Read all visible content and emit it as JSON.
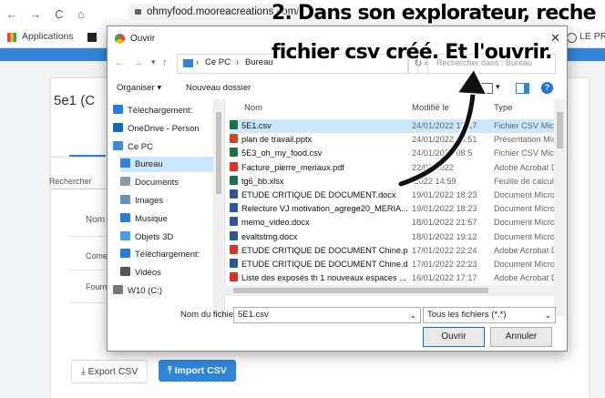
{
  "browser": {
    "back": "←",
    "forward": "→",
    "reload": "C",
    "home": "⌂",
    "url": "ohmyfood.mooreacreations.com/",
    "bookmarks": {
      "apps": "Applications",
      "right": "LE PR"
    }
  },
  "page": {
    "heading": "5e1 (C",
    "search_label": "Rechercher",
    "col_name": "Nom",
    "row1": "Comer",
    "row2": "Fourm",
    "export_label": "Export CSV",
    "import_label": "Import CSV"
  },
  "dialog": {
    "title": "Ouvrir",
    "path": {
      "root": "Ce PC",
      "sep": "›",
      "folder": "Bureau",
      "search_placeholder": "Rechercher dans : Bureau"
    },
    "toolbar": {
      "organize": "Organiser ▾",
      "new_folder": "Nouveau dossier"
    },
    "nav": [
      {
        "label": "Téléchargement:",
        "icon": "download-icon",
        "color": "#2b7cd3"
      },
      {
        "label": "OneDrive - Person",
        "icon": "cloud-icon",
        "color": "#0f6cbd"
      },
      {
        "label": "Ce PC",
        "icon": "computer-icon",
        "color": "#3c8ad8"
      },
      {
        "label": "Bureau",
        "icon": "desktop-icon",
        "color": "#2f86d8",
        "selected": true
      },
      {
        "label": "Documents",
        "icon": "documents-icon",
        "color": "#8a9bb0"
      },
      {
        "label": "Images",
        "icon": "images-icon",
        "color": "#6b8fb8"
      },
      {
        "label": "Musique",
        "icon": "music-icon",
        "color": "#2b7cd3"
      },
      {
        "label": "Objets 3D",
        "icon": "cube-icon",
        "color": "#4aa0e6"
      },
      {
        "label": "Téléchargement:",
        "icon": "download-icon",
        "color": "#2b7cd3"
      },
      {
        "label": "Vidéos",
        "icon": "video-icon",
        "color": "#555555"
      },
      {
        "label": "W10 (C:)",
        "icon": "drive-icon",
        "color": "#777777"
      }
    ],
    "columns": {
      "name": "Nom",
      "modified": "Modifié le",
      "type": "Type"
    },
    "files": [
      {
        "name": "5E1.csv",
        "date": "24/01/2022 13:17",
        "type": "Fichier CSV Micro",
        "icon": "excel-icon",
        "color": "#1e7145",
        "selected": true
      },
      {
        "name": "plan de travail.pptx",
        "date": "24/01/2022 09:51",
        "type": "Présentation Micr",
        "icon": "powerpoint-icon",
        "color": "#d04423"
      },
      {
        "name": "5E3_oh_my_food.csv",
        "date": "24/01/2022 08:5",
        "type": "Fichier CSV Micro",
        "icon": "excel-icon",
        "color": "#1e7145"
      },
      {
        "name": "Facture_pierre_meriaux.pdf",
        "date": "22/01/2022 ",
        "type": "Adobe Acrobat D",
        "icon": "pdf-icon",
        "color": "#d9342b"
      },
      {
        "name": "tg6_bb.xlsx",
        "date": "/2022 14:59",
        "type": "Feuille de calcul .",
        "icon": "excel-icon",
        "color": "#1e7145"
      },
      {
        "name": "ETUDE CRITIQUE DE DOCUMENT.docx",
        "date": "19/01/2022 18:23",
        "type": "Document Micros",
        "icon": "word-icon",
        "color": "#2b579a"
      },
      {
        "name": "Relecture VJ motivation_agrege20_MERIA...",
        "date": "19/01/2022 18:23",
        "type": "Document Micros",
        "icon": "word-icon",
        "color": "#2b579a"
      },
      {
        "name": "memo_video.docx",
        "date": "18/01/2022 21:57",
        "type": "Document Micros",
        "icon": "word-icon",
        "color": "#2b579a"
      },
      {
        "name": "evaltstmg.docx",
        "date": "18/01/2022 19:12",
        "type": "Document Micros",
        "icon": "word-icon",
        "color": "#2b579a"
      },
      {
        "name": "ETUDE CRITIQUE DE DOCUMENT Chine.p...",
        "date": "17/01/2022 22:24",
        "type": "Adobe Acrobat D",
        "icon": "pdf-icon",
        "color": "#d9342b"
      },
      {
        "name": "ETUDE CRITIQUE DE DOCUMENT Chine.d...",
        "date": "17/01/2022 22:23",
        "type": "Document Micros",
        "icon": "word-icon",
        "color": "#2b579a"
      },
      {
        "name": "Liste des exposés th 1 nouveaux espaces ...",
        "date": "16/01/2022 17:17",
        "type": "Adobe Acrobat D",
        "icon": "pdf-icon",
        "color": "#d9342b"
      }
    ],
    "filename_label": "Nom du fichier :",
    "filename_value": "5E1.csv",
    "filter_value": "Tous les fichiers (*.*)",
    "open_label": "Ouvrir",
    "cancel_label": "Annuler"
  },
  "annotation": {
    "line1": "2. Dans son explorateur, reche",
    "line2": "fichier csv créé. Et l'ouvrir."
  },
  "colors": {
    "accent": "#2f86d8",
    "selection": "#cce8ff"
  }
}
